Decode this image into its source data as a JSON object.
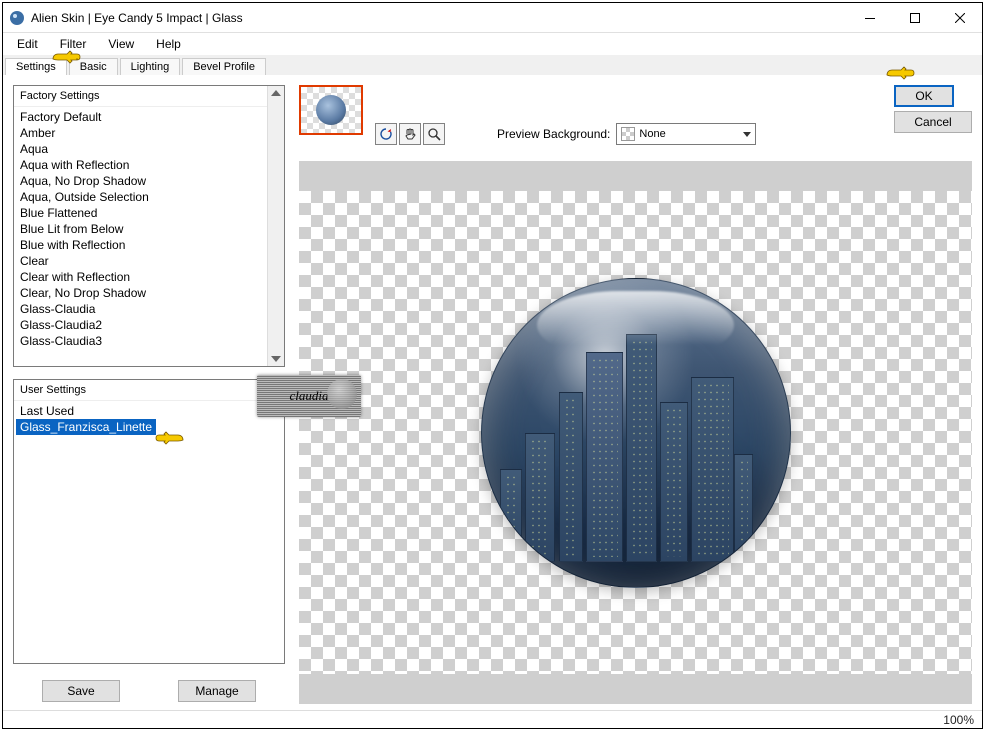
{
  "titlebar": {
    "title": "Alien Skin | Eye Candy 5 Impact | Glass"
  },
  "menus": [
    "Edit",
    "Filter",
    "View",
    "Help"
  ],
  "tabs": [
    "Settings",
    "Basic",
    "Lighting",
    "Bevel Profile"
  ],
  "active_tab": 0,
  "factory": {
    "header": "Factory Settings",
    "items": [
      "Factory Default",
      "Amber",
      "Aqua",
      "Aqua with Reflection",
      "Aqua, No Drop Shadow",
      "Aqua, Outside Selection",
      "Blue Flattened",
      "Blue Lit from Below",
      "Blue with Reflection",
      "Clear",
      "Clear with Reflection",
      "Clear, No Drop Shadow",
      "Glass-Claudia",
      "Glass-Claudia2",
      "Glass-Claudia3"
    ]
  },
  "user": {
    "header": "User Settings",
    "items": [
      "Last Used",
      "Glass_Franzisca_Linette"
    ],
    "selected_index": 1
  },
  "buttons": {
    "save": "Save",
    "manage": "Manage",
    "ok": "OK",
    "cancel": "Cancel"
  },
  "preview_bg": {
    "label": "Preview Background:",
    "value": "None"
  },
  "status": {
    "zoom": "100%"
  },
  "badge": "claudia"
}
